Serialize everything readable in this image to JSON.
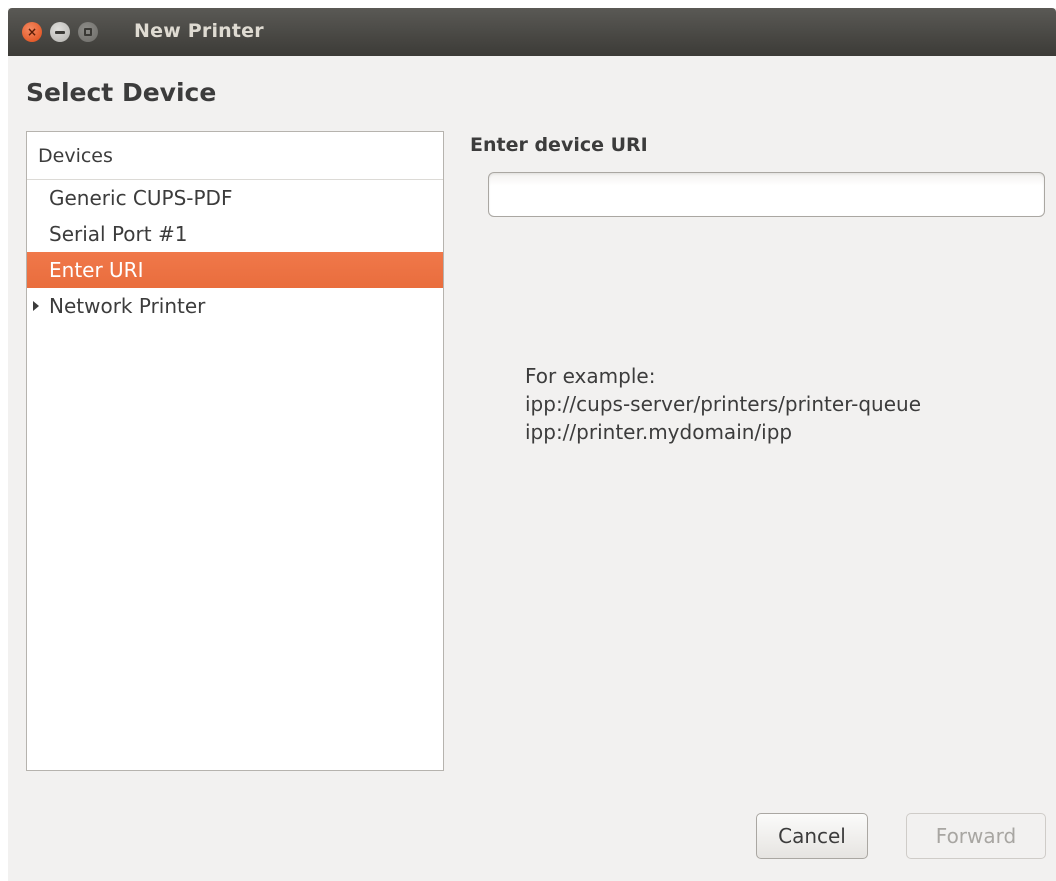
{
  "window": {
    "title": "New Printer"
  },
  "heading": "Select Device",
  "device_list": {
    "header": "Devices",
    "items": [
      {
        "label": "Generic CUPS-PDF",
        "selected": false,
        "expandable": false
      },
      {
        "label": "Serial Port #1",
        "selected": false,
        "expandable": false
      },
      {
        "label": "Enter URI",
        "selected": true,
        "expandable": false
      },
      {
        "label": "Network Printer",
        "selected": false,
        "expandable": true
      }
    ]
  },
  "uri_panel": {
    "label": "Enter device URI",
    "input_value": "",
    "example_lines": [
      "For example:",
      "ipp://cups-server/printers/printer-queue",
      "ipp://printer.mydomain/ipp"
    ]
  },
  "buttons": {
    "cancel": "Cancel",
    "forward": "Forward"
  },
  "colors": {
    "selection": "#e96d3d",
    "titlebar": "#3c3b37"
  }
}
